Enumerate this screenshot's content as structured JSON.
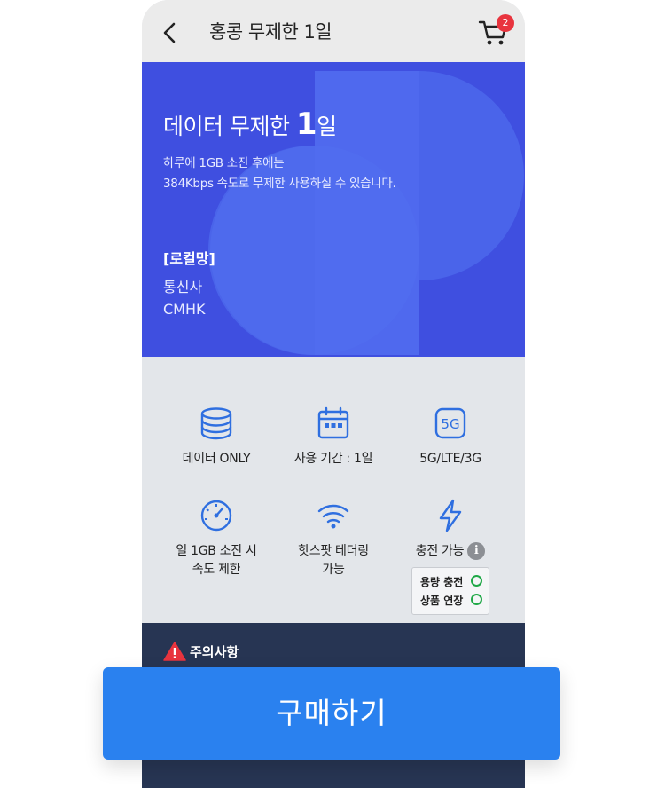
{
  "header": {
    "title": "홍콩 무제한 1일",
    "cart_count": "2"
  },
  "hero": {
    "title_prefix": "데이터 무제한 ",
    "title_number": "1",
    "title_suffix": "일",
    "desc_line1": "하루에 1GB 소진 후에는",
    "desc_line2": "384Kbps 속도로 무제한 사용하실 수 있습니다.",
    "network_heading": "[로컬망]",
    "network_label": "통신사",
    "network_value": "CMHK",
    "colors": {
      "background": "#3f4fe0",
      "shape": "#4a64ea"
    }
  },
  "features": [
    {
      "icon": "database-icon",
      "label": "데이터 ONLY"
    },
    {
      "icon": "calendar-icon",
      "label": "사용 기간 : 1일"
    },
    {
      "icon": "5g-icon",
      "label": "5G/LTE/3G"
    },
    {
      "icon": "speedometer-icon",
      "label_line1": "일 1GB 소진 시",
      "label_line2": "속도 제한"
    },
    {
      "icon": "wifi-icon",
      "label_line1": "핫스팟 테더링",
      "label_line2": "가능"
    },
    {
      "icon": "lightning-icon",
      "label": "충전 가능"
    }
  ],
  "charge_options": [
    {
      "label": "용량 충전",
      "available": true
    },
    {
      "label": "상품 연장",
      "available": true
    }
  ],
  "notice": {
    "label": "주의사항",
    "icon": "warning-icon"
  },
  "buy_button": {
    "label": "구매하기",
    "color": "#2a81ef"
  },
  "colors": {
    "accent": "#2f6fe0",
    "notice_bg": "#273553",
    "badge": "#e8343e",
    "check": "#1fa847"
  }
}
